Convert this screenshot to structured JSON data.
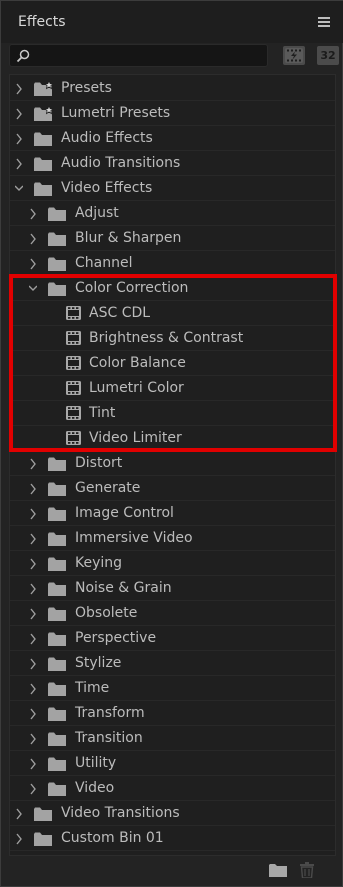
{
  "panel": {
    "title": "Effects",
    "toolbar": {
      "accelerated_label": "⚡",
      "bit32_label": "32"
    },
    "search": {
      "value": "",
      "placeholder": ""
    }
  },
  "tree": [
    {
      "label": "Presets",
      "level": 0,
      "type": "preset-folder",
      "expanded": false
    },
    {
      "label": "Lumetri Presets",
      "level": 0,
      "type": "preset-folder",
      "expanded": false
    },
    {
      "label": "Audio Effects",
      "level": 0,
      "type": "folder",
      "expanded": false
    },
    {
      "label": "Audio Transitions",
      "level": 0,
      "type": "folder",
      "expanded": false
    },
    {
      "label": "Video Effects",
      "level": 0,
      "type": "folder",
      "expanded": true
    },
    {
      "label": "Adjust",
      "level": 1,
      "type": "folder",
      "expanded": false
    },
    {
      "label": "Blur & Sharpen",
      "level": 1,
      "type": "folder",
      "expanded": false
    },
    {
      "label": "Channel",
      "level": 1,
      "type": "folder",
      "expanded": false
    },
    {
      "label": "Color Correction",
      "level": 1,
      "type": "folder",
      "expanded": true
    },
    {
      "label": "ASC CDL",
      "level": 2,
      "type": "effect"
    },
    {
      "label": "Brightness & Contrast",
      "level": 2,
      "type": "effect"
    },
    {
      "label": "Color Balance",
      "level": 2,
      "type": "effect"
    },
    {
      "label": "Lumetri Color",
      "level": 2,
      "type": "effect"
    },
    {
      "label": "Tint",
      "level": 2,
      "type": "effect"
    },
    {
      "label": "Video Limiter",
      "level": 2,
      "type": "effect"
    },
    {
      "label": "Distort",
      "level": 1,
      "type": "folder",
      "expanded": false
    },
    {
      "label": "Generate",
      "level": 1,
      "type": "folder",
      "expanded": false
    },
    {
      "label": "Image Control",
      "level": 1,
      "type": "folder",
      "expanded": false
    },
    {
      "label": "Immersive Video",
      "level": 1,
      "type": "folder",
      "expanded": false
    },
    {
      "label": "Keying",
      "level": 1,
      "type": "folder",
      "expanded": false
    },
    {
      "label": "Noise & Grain",
      "level": 1,
      "type": "folder",
      "expanded": false
    },
    {
      "label": "Obsolete",
      "level": 1,
      "type": "folder",
      "expanded": false
    },
    {
      "label": "Perspective",
      "level": 1,
      "type": "folder",
      "expanded": false
    },
    {
      "label": "Stylize",
      "level": 1,
      "type": "folder",
      "expanded": false
    },
    {
      "label": "Time",
      "level": 1,
      "type": "folder",
      "expanded": false
    },
    {
      "label": "Transform",
      "level": 1,
      "type": "folder",
      "expanded": false
    },
    {
      "label": "Transition",
      "level": 1,
      "type": "folder",
      "expanded": false
    },
    {
      "label": "Utility",
      "level": 1,
      "type": "folder",
      "expanded": false
    },
    {
      "label": "Video",
      "level": 1,
      "type": "folder",
      "expanded": false
    },
    {
      "label": "Video Transitions",
      "level": 0,
      "type": "folder",
      "expanded": false
    },
    {
      "label": "Custom Bin 01",
      "level": 0,
      "type": "folder",
      "expanded": false
    }
  ],
  "colors": {
    "highlight": "#e10000",
    "folder": "#a3a3a3",
    "text": "#bcbcbc"
  },
  "icons": {
    "new_bin": "folder-icon",
    "delete": "trash-icon"
  }
}
